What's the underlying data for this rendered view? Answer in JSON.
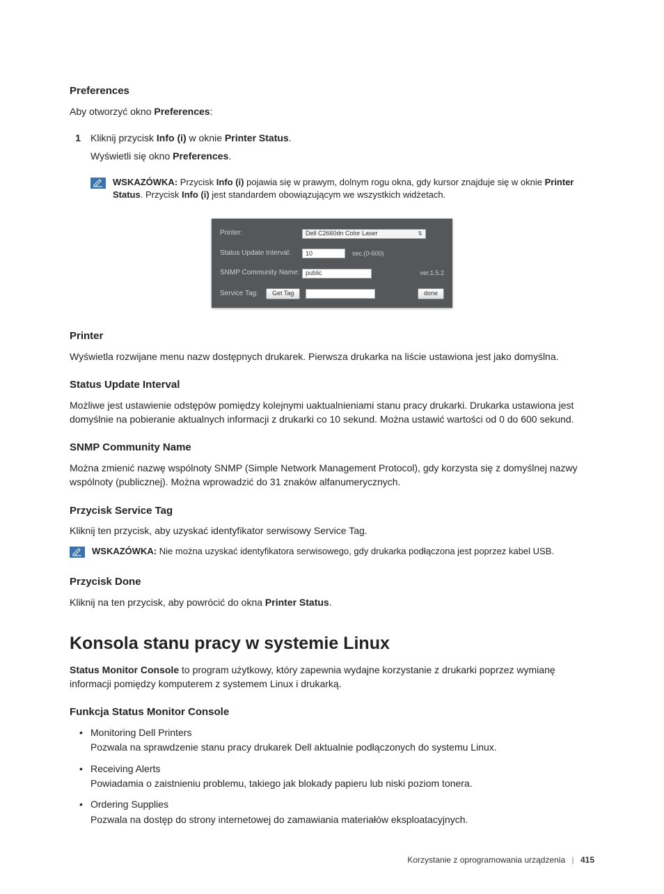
{
  "heading_preferences": "Preferences",
  "open_prefs_text_a": "Aby otworzyć okno ",
  "open_prefs_bold": "Preferences",
  "open_prefs_text_b": ":",
  "step1_num": "1",
  "step1_a": "Kliknij przycisk ",
  "step1_b1": "Info (i)",
  "step1_c": " w oknie ",
  "step1_b2": "Printer Status",
  "step1_d": ".",
  "step1_sub_a": "Wyświetli się okno ",
  "step1_sub_b": "Preferences",
  "step1_sub_c": ".",
  "note1_label": "WSKAZÓWKA:",
  "note1_a": " Przycisk ",
  "note1_b1": "Info (i)",
  "note1_c": " pojawia się w prawym, dolnym rogu okna, gdy kursor znajduje się w oknie ",
  "note1_b2": "Printer Status",
  "note1_d": ". Przycisk ",
  "note1_b3": "Info (i)",
  "note1_e": " jest standardem obowiązującym we wszystkich widżetach.",
  "panel": {
    "printer_label": "Printer:",
    "printer_value": "Dell C2660dn Color Laser",
    "interval_label": "Status Update Interval:",
    "interval_value": "10",
    "interval_suffix": "sec.(0-600)",
    "snmp_label": "SNMP Community Name:",
    "snmp_value": "public",
    "version": "ver.1.5.2",
    "service_label": "Service Tag:",
    "get_tag_btn": "Get Tag",
    "service_value": "",
    "done_btn": "done"
  },
  "sec_printer_h": "Printer",
  "sec_printer_t": "Wyświetla rozwijane menu nazw dostępnych drukarek. Pierwsza drukarka na liście ustawiona jest jako domyślna.",
  "sec_interval_h": "Status Update Interval",
  "sec_interval_t": "Możliwe jest ustawienie odstępów pomiędzy kolejnymi uaktualnieniami stanu pracy drukarki. Drukarka ustawiona jest domyślnie na pobieranie aktualnych informacji z drukarki co 10 sekund. Można ustawić wartości od 0 do 600 sekund.",
  "sec_snmp_h": "SNMP Community Name",
  "sec_snmp_t": "Można zmienić nazwę wspólnoty SNMP (Simple Network Management Protocol), gdy korzysta się z domyślnej nazwy wspólnoty (publicznej). Można wprowadzić do 31 znaków alfanumerycznych.",
  "sec_service_h": "Przycisk Service Tag",
  "sec_service_t": "Kliknij ten przycisk, aby uzyskać identyfikator serwisowy Service Tag.",
  "note2_label": "WSKAZÓWKA:",
  "note2_t": " Nie można uzyskać identyfikatora serwisowego, gdy drukarka podłączona jest poprzez kabel USB.",
  "sec_done_h": "Przycisk Done",
  "sec_done_a": "Kliknij na ten przycisk, aby powrócić do okna ",
  "sec_done_b": "Printer Status",
  "sec_done_c": ".",
  "h2_linux": "Konsola stanu pracy w systemie Linux",
  "linux_intro_a": "Status Monitor Console",
  "linux_intro_b": " to program użytkowy, który zapewnia wydajne korzystanie z drukarki poprzez wymianę informacji pomiędzy komputerem z systemem Linux i drukarką.",
  "h3_func": "Funkcja Status Monitor Console",
  "bullets": [
    {
      "title": "Monitoring Dell Printers",
      "body": "Pozwala na sprawdzenie stanu pracy drukarek Dell aktualnie podłączonych do systemu Linux."
    },
    {
      "title": "Receiving Alerts",
      "body": "Powiadamia o zaistnieniu problemu, takiego jak blokady papieru lub niski poziom tonera."
    },
    {
      "title": "Ordering Supplies",
      "body": "Pozwala na dostęp do strony internetowej do zamawiania materiałów eksploatacyjnych."
    }
  ],
  "footer_text": "Korzystanie z oprogramowania urządzenia",
  "footer_page": "415"
}
